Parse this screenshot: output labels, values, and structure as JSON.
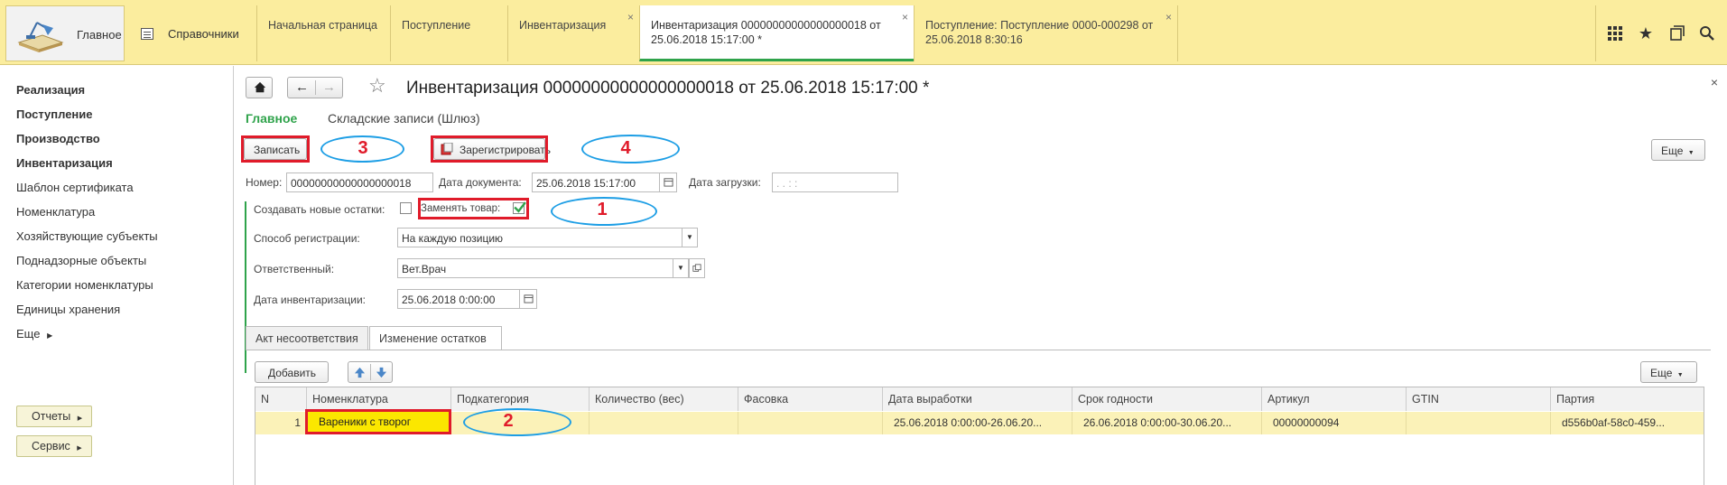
{
  "topbar": {
    "home_label": "Главное",
    "refs_label": "Справочники",
    "tabs": [
      {
        "label": "Начальная страница",
        "closable": false
      },
      {
        "label": "Поступление",
        "closable": false
      },
      {
        "label": "Инвентаризация",
        "closable": true
      },
      {
        "label": "Инвентаризация 00000000000000000018 от 25.06.2018 15:17:00 *",
        "closable": true
      },
      {
        "label": "Поступление: Поступление 0000-000298 от 25.06.2018 8:30:16",
        "closable": true
      }
    ],
    "close_glyph": "×",
    "icons": [
      "apps-grid-icon",
      "star-icon",
      "history-icon",
      "search-icon"
    ]
  },
  "sidebar": {
    "items": [
      {
        "label": "Реализация",
        "bold": true
      },
      {
        "label": "Поступление",
        "bold": true
      },
      {
        "label": "Производство",
        "bold": true
      },
      {
        "label": "Инвентаризация",
        "bold": true
      },
      {
        "label": "Шаблон сертификата",
        "bold": false
      },
      {
        "label": "Номенклатура",
        "bold": false
      },
      {
        "label": "Хозяйствующие субъекты",
        "bold": false
      },
      {
        "label": "Поднадзорные объекты",
        "bold": false
      },
      {
        "label": "Категории номенклатуры",
        "bold": false
      },
      {
        "label": "Единицы хранения",
        "bold": false
      },
      {
        "label": "Еще",
        "bold": false
      }
    ],
    "buttons": [
      "Отчеты",
      "Сервис"
    ]
  },
  "form": {
    "title": "Инвентаризация 00000000000000000018 от 25.06.2018 15:17:00 *",
    "tabs": [
      "Главное",
      "Складские записи (Шлюз)"
    ],
    "write_button": "Записать",
    "register_button": "Зарегистрировать",
    "more_button": "Еще",
    "fields": {
      "number_label": "Номер:",
      "number_value": "00000000000000000018",
      "doc_date_label": "Дата документа:",
      "doc_date_value": "25.06.2018 15:17:00",
      "load_date_label": "Дата загрузки:",
      "load_date_value": " .  .       :  :",
      "create_new_label": "Создавать новые остатки:",
      "create_new_checked": false,
      "replace_label": "Заменять товар:",
      "replace_checked": true,
      "reg_method_label": "Способ регистрации:",
      "reg_method_value": "На каждую позицию",
      "responsible_label": "Ответственный:",
      "responsible_value": "Вет.Врач",
      "inv_date_label": "Дата инвентаризации:",
      "inv_date_value": "25.06.2018  0:00:00"
    },
    "subtabs": [
      "Акт несоответствия",
      "Изменение остатков"
    ],
    "add_button": "Добавить",
    "columns": [
      "N",
      "Номенклатура",
      "Подкатегория",
      "Количество (вес)",
      "Фасовка",
      "Дата выработки",
      "Срок годности",
      "Артикул",
      "GTIN",
      "Партия"
    ],
    "rows": [
      [
        "1",
        "Вареники с творог",
        "",
        "",
        "",
        "25.06.2018 0:00:00-26.06.20...",
        "26.06.2018 0:00:00-30.06.20...",
        "00000000094",
        "",
        "d556b0af-58c0-459..."
      ]
    ]
  },
  "annotations": {
    "numbers": [
      "1",
      "2",
      "3",
      "4"
    ],
    "highlight_color": "#e01b2a",
    "ellipse_color": "#1d9ee5"
  },
  "colors": {
    "topbar": "#fbed9e",
    "accent_green": "#2fa34b",
    "row_highlight": "#fbf2b8"
  }
}
